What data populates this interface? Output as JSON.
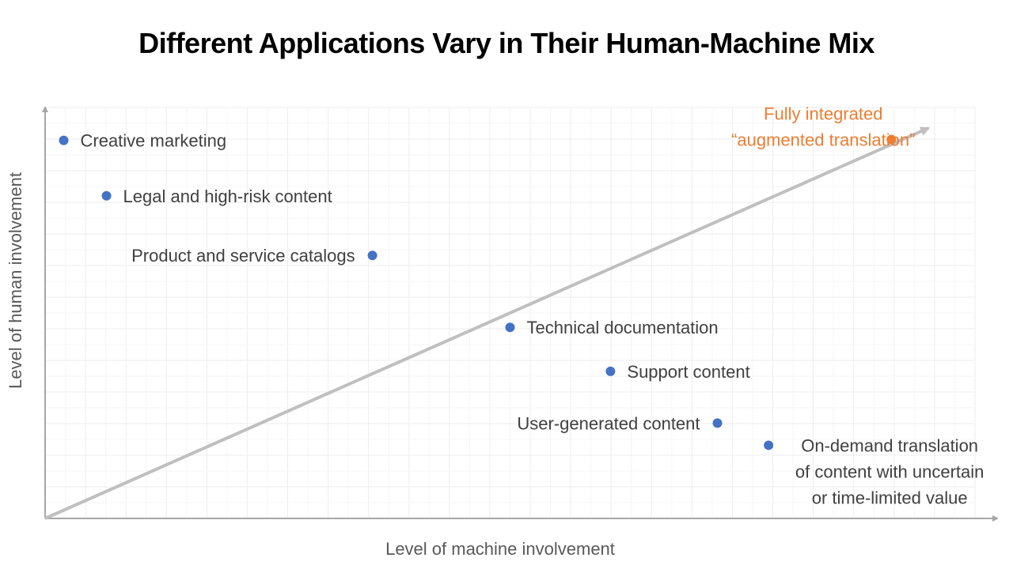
{
  "chart_data": {
    "type": "scatter",
    "title": "Different Applications Vary in Their Human-Machine Mix",
    "xlabel": "Level of machine involvement",
    "ylabel": "Level of human involvement",
    "xlim": [
      0,
      100
    ],
    "ylim": [
      0,
      100
    ],
    "grid": true,
    "trend_arrow": {
      "from": [
        0,
        0
      ],
      "to": [
        95,
        95
      ]
    },
    "colors": {
      "point": "#4472C4",
      "highlight": "#ED7D31",
      "label": "#404040",
      "axis": "#A6A6A6",
      "grid": "#EDEDED",
      "arrow": "#BFBFBF"
    },
    "points": [
      {
        "label": [
          "Creative marketing"
        ],
        "x": 2,
        "y": 92,
        "label_side": "right"
      },
      {
        "label": [
          "Legal and high-risk content"
        ],
        "x": 6.6,
        "y": 78.5,
        "label_side": "right"
      },
      {
        "label": [
          "Product and service catalogs"
        ],
        "x": 35.2,
        "y": 64,
        "label_side": "left"
      },
      {
        "label": [
          "Technical documentation"
        ],
        "x": 50,
        "y": 46.5,
        "label_side": "right"
      },
      {
        "label": [
          "Support content"
        ],
        "x": 60.8,
        "y": 35.8,
        "label_side": "right"
      },
      {
        "label": [
          "User-generated content"
        ],
        "x": 72.3,
        "y": 23.2,
        "label_side": "left"
      },
      {
        "label": [
          "On-demand translation",
          "of content with uncertain",
          "or time-limited value"
        ],
        "x": 77.8,
        "y": 17.8,
        "label_side": "below-right"
      },
      {
        "label": [
          "Fully integrated",
          "“augmented translation”"
        ],
        "x": 91,
        "y": 92.2,
        "label_side": "above-left",
        "highlight": true
      }
    ]
  }
}
